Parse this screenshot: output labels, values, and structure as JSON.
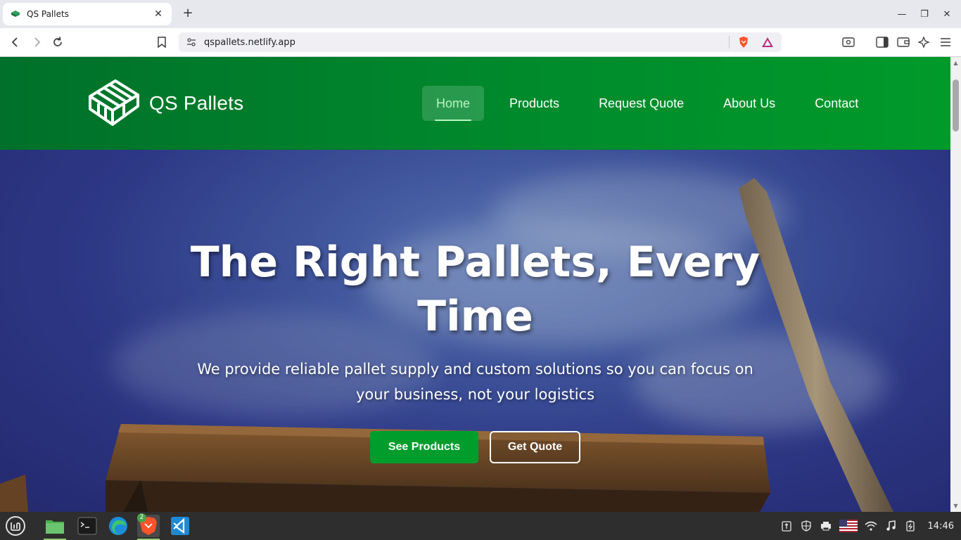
{
  "browser": {
    "tab": {
      "title": "QS Pallets",
      "favicon": "pallet-favicon"
    },
    "url": "qspallets.netlify.app",
    "icons": [
      "back-icon",
      "forward-icon",
      "reload-icon",
      "bookmark-icon",
      "site-info-icon",
      "brave-shields-icon",
      "brave-rewards-icon",
      "search-tabs-icon",
      "sidebar-icon",
      "wallet-icon",
      "leo-ai-icon",
      "menu-icon"
    ]
  },
  "site": {
    "brand": "QS Pallets",
    "nav": [
      {
        "label": "Home",
        "active": true
      },
      {
        "label": "Products",
        "active": false
      },
      {
        "label": "Request Quote",
        "active": false
      },
      {
        "label": "About Us",
        "active": false
      },
      {
        "label": "Contact",
        "active": false
      }
    ],
    "hero": {
      "title_line1": "The Right Pallets, Every",
      "title_line2": "Time",
      "subtitle": "We provide reliable pallet supply and custom solutions so you can focus on your business, not your logistics",
      "primary_button": "See Products",
      "secondary_button": "Get Quote"
    }
  },
  "taskbar": {
    "apps": [
      "mint-menu-icon",
      "files-icon",
      "terminal-icon",
      "edge-icon",
      "brave-icon",
      "vscode-icon"
    ],
    "brave_badge": "2",
    "clock": "14:46"
  },
  "colors": {
    "header_green": "#008a2c",
    "button_green": "#009d2c",
    "active_nav_text": "#b8f5c2"
  }
}
